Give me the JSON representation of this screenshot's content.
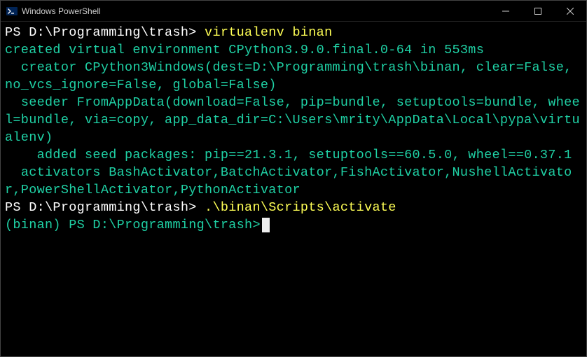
{
  "titlebar": {
    "title": "Windows PowerShell"
  },
  "terminal": {
    "line1_prompt": "PS D:\\Programming\\trash> ",
    "line1_cmd": "virtualenv binan",
    "out1": "created virtual environment CPython3.9.0.final.0-64 in 553ms",
    "out2": "  creator CPython3Windows(dest=D:\\Programming\\trash\\binan, clear=False, no_vcs_ignore=False, global=False)",
    "out3": "  seeder FromAppData(download=False, pip=bundle, setuptools=bundle, wheel=bundle, via=copy, app_data_dir=C:\\Users\\mrity\\AppData\\Local\\pypa\\virtualenv)",
    "out4": "    added seed packages: pip==21.3.1, setuptools==60.5.0, wheel==0.37.1",
    "out5": "  activators BashActivator,BatchActivator,FishActivator,NushellActivator,PowerShellActivator,PythonActivator",
    "line2_prompt": "PS D:\\Programming\\trash> ",
    "line2_cmd": ".\\binan\\Scripts\\activate",
    "line3_prompt": "(binan) PS D:\\Programming\\trash>"
  }
}
